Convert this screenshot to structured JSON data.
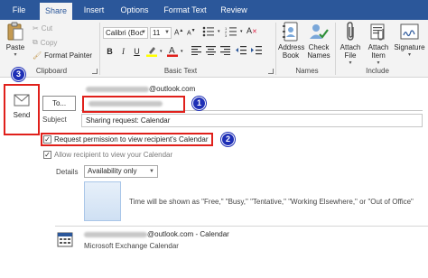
{
  "tabs": [
    {
      "label": "File",
      "active": false
    },
    {
      "label": "Share",
      "active": true
    },
    {
      "label": "Insert",
      "active": false
    },
    {
      "label": "Options",
      "active": false
    },
    {
      "label": "Format Text",
      "active": false
    },
    {
      "label": "Review",
      "active": false
    }
  ],
  "ribbon": {
    "clipboard": {
      "paste_label": "Paste",
      "cut_label": "Cut",
      "copy_label": "Copy",
      "format_painter_label": "Format Painter",
      "group_label": "Clipboard"
    },
    "basic_text": {
      "font_name": "Calibri (Boc",
      "font_size": "11",
      "bold": "B",
      "italic": "I",
      "underline": "U",
      "group_label": "Basic Text"
    },
    "names": {
      "address_book_label": "Address Book",
      "check_names_label": "Check Names",
      "group_label": "Names"
    },
    "include": {
      "attach_file_label": "Attach File",
      "attach_item_label": "Attach Item",
      "signature_label": "Signature",
      "group_label": "Include"
    }
  },
  "colors": {
    "tab_bar": "#2b579a",
    "highlight_box": "#e0201b",
    "badge": "#1e2fb6"
  },
  "message": {
    "send_label": "Send",
    "from_suffix": "@outlook.com",
    "to_button_label": "To...",
    "subject_label": "Subject",
    "subject_value": "Sharing request: Calendar",
    "request_permission_label": "Request permission to view recipient's Calendar",
    "request_permission_checked": true,
    "allow_view_label": "Allow recipient to view your Calendar",
    "allow_view_checked": true,
    "details_label": "Details",
    "details_value": "Availability only",
    "time_note": "Time will be shown as \"Free,\" \"Busy,\" \"Tentative,\" \"Working Elsewhere,\" or \"Out of Office\"",
    "calendar_owner_suffix": "@outlook.com - Calendar",
    "calendar_source": "Microsoft Exchange Calendar"
  },
  "badges": [
    "1",
    "2",
    "3"
  ]
}
